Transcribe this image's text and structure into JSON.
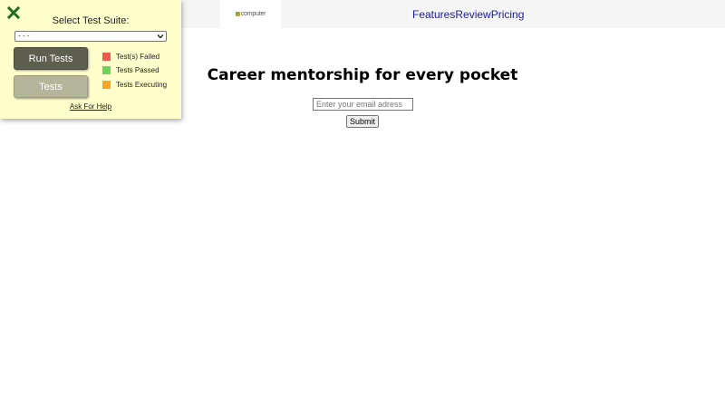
{
  "header": {
    "logo_text": "computer",
    "nav": [
      "Features",
      "Review",
      "Pricing"
    ]
  },
  "hero": {
    "title": "Career mentorship for every pocket",
    "email_placeholder": "Enter your email adress",
    "submit_label": "Submit"
  },
  "test_panel": {
    "close_icon": "close-x-icon",
    "title": "Select Test Suite:",
    "selected_suite": "- - -",
    "run_button": "Run Tests",
    "tests_button": "Tests",
    "legend": [
      {
        "label": "Test(s) Failed",
        "color": "#f05a4a"
      },
      {
        "label": "Tests Passed",
        "color": "#6fd35a"
      },
      {
        "label": "Tests Executing",
        "color": "#f5a623"
      }
    ],
    "help_link": "Ask For Help",
    "close_color": "#1f6e1f",
    "panel_bg": "#ffffcc"
  }
}
